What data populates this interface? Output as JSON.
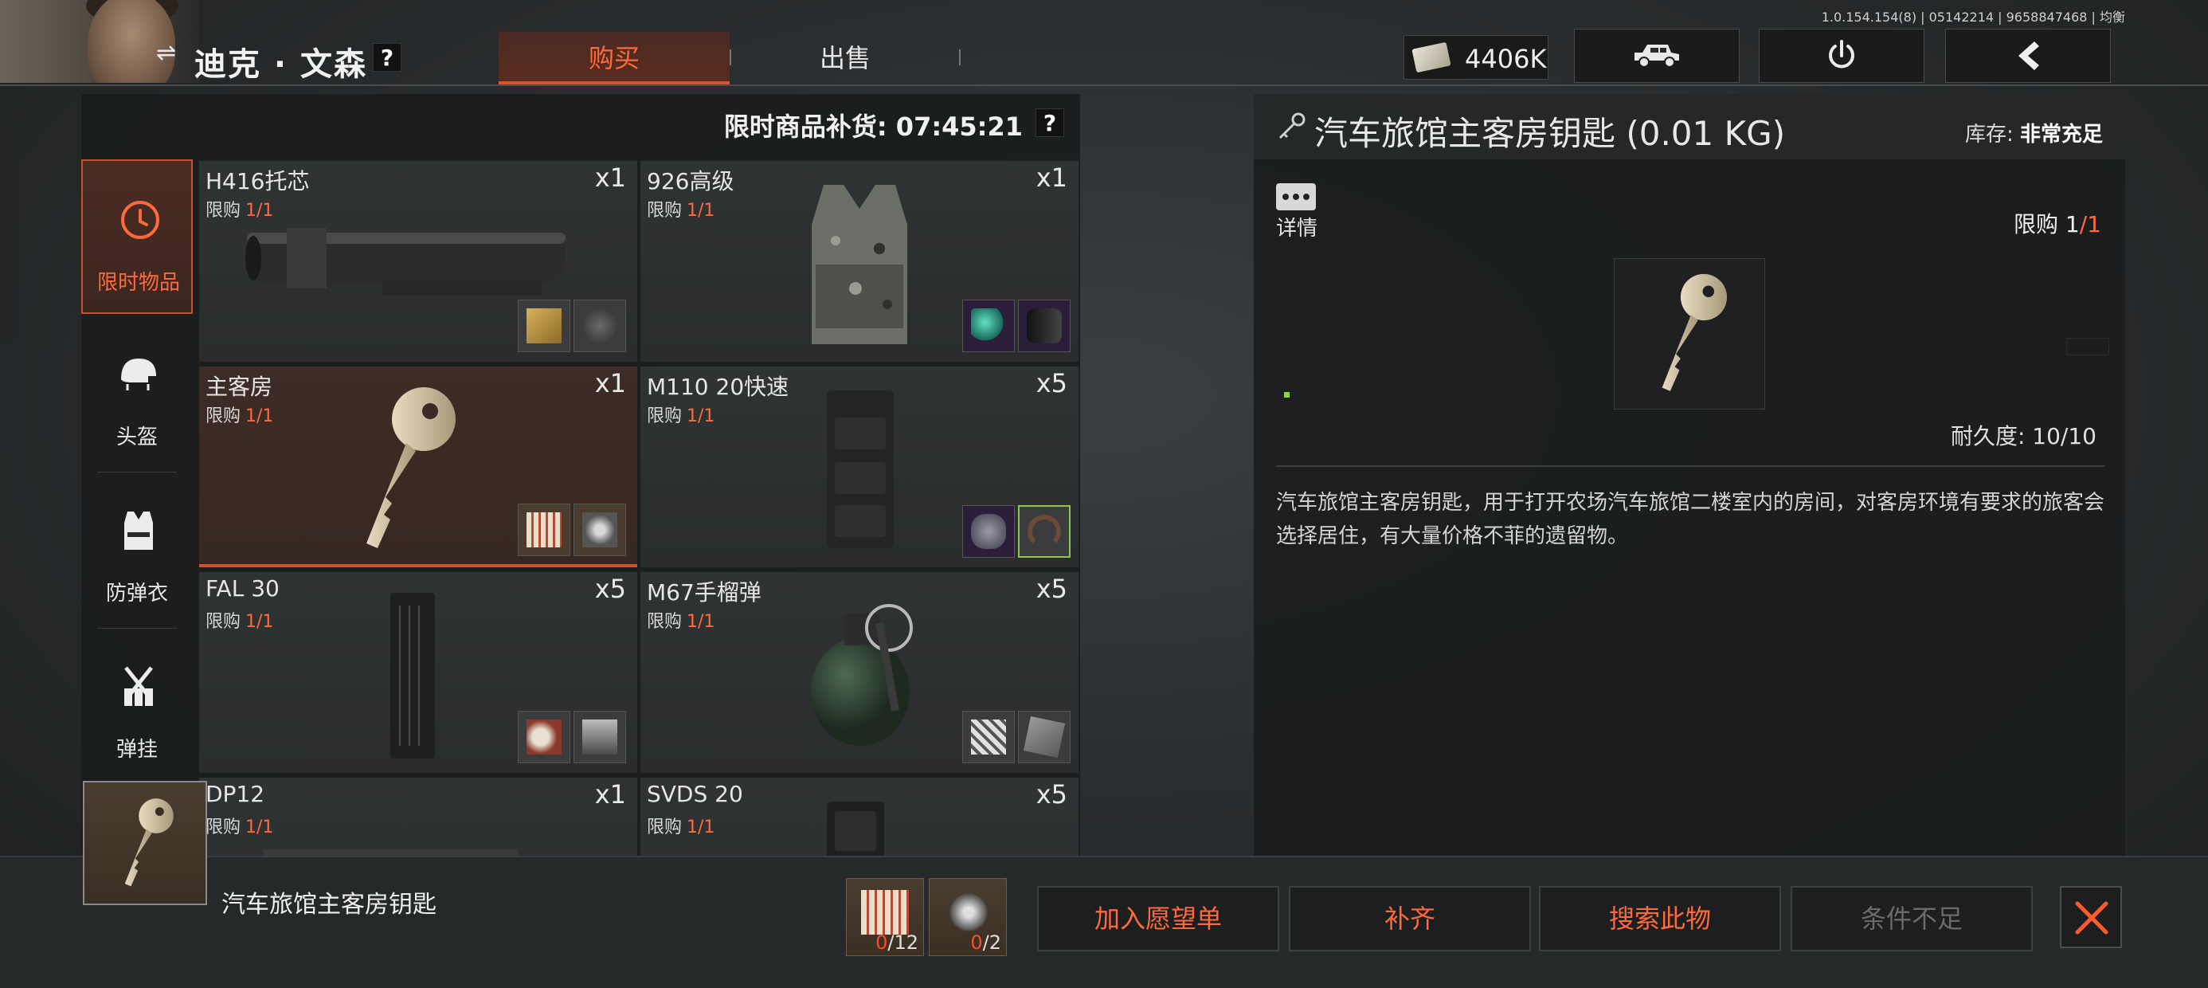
{
  "app": {
    "version": "1.0.154.154(8) | 05142214 | 9658847468 | 均衡"
  },
  "player": {
    "name": "迪克 · 文森",
    "help": "?"
  },
  "tabs": [
    {
      "label": "购买",
      "active": true
    },
    {
      "label": "出售",
      "active": false
    }
  ],
  "wallet": {
    "amount": "4406K"
  },
  "toolbar": {
    "vehicle_icon": "jeep-icon",
    "power_icon": "power-icon",
    "back_icon": "chevron-left-icon"
  },
  "shop": {
    "restock_label": "限时商品补货: 07:45:21",
    "help": "?",
    "categories": [
      {
        "label": "限时物品",
        "icon": "clock-icon",
        "active": true
      },
      {
        "label": "头盔",
        "icon": "helmet-icon",
        "active": false
      },
      {
        "label": "防弹衣",
        "icon": "vest-icon",
        "active": false
      },
      {
        "label": "弹挂",
        "icon": "chest-rig-icon",
        "active": false
      }
    ],
    "limit_prefix": "限购",
    "items": [
      {
        "name": "H416托芯",
        "limit": "1/1",
        "qty": "x1"
      },
      {
        "name": "926高级",
        "limit": "1/1",
        "qty": "x1"
      },
      {
        "name": "主客房",
        "limit": "1/1",
        "qty": "x1",
        "selected": true
      },
      {
        "name": "M110 20快速",
        "limit": "1/1",
        "qty": "x5"
      },
      {
        "name": "FAL 30",
        "limit": "1/1",
        "qty": "x5"
      },
      {
        "name": "M67手榴弹",
        "limit": "1/1",
        "qty": "x5"
      },
      {
        "name": "DP12",
        "limit": "1/1",
        "qty": "x1"
      },
      {
        "name": "SVDS 20",
        "limit": "1/1",
        "qty": "x5"
      }
    ]
  },
  "detail": {
    "title": "汽车旅馆主客房钥匙 (0.01 KG)",
    "stock_label": "库存:",
    "stock_value": "非常充足",
    "details_label": "详情",
    "limit_label": "限购",
    "limit_have": "1",
    "limit_max": "/1",
    "durability": "耐久度: 10/10",
    "description": "汽车旅馆主客房钥匙，用于打开农场汽车旅馆二楼室内的房间，对客房环境有要求的旅客会选择居住，有大量价格不菲的遗留物。"
  },
  "bottom": {
    "item_name": "汽车旅馆主客房钥匙",
    "requirements": [
      {
        "have": "0",
        "need": "/12"
      },
      {
        "have": "0",
        "need": "/2"
      }
    ],
    "actions": [
      {
        "label": "加入愿望单",
        "enabled": true
      },
      {
        "label": "补齐",
        "enabled": true
      },
      {
        "label": "搜索此物",
        "enabled": true
      },
      {
        "label": "条件不足",
        "enabled": false
      }
    ],
    "close_icon": "close-icon"
  },
  "colors": {
    "accent": "#ff6a3c",
    "panel": "#1a1c1d",
    "selected": "#3e2c26"
  }
}
